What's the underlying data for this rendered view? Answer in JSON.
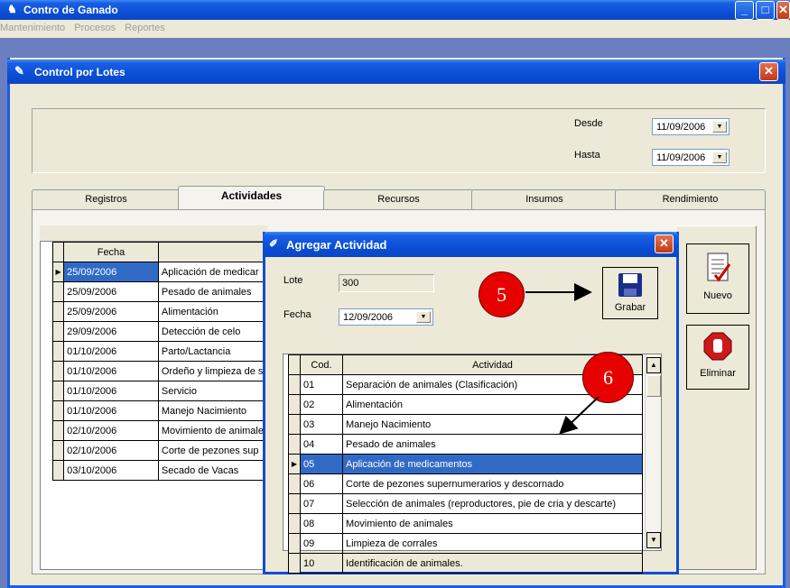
{
  "app": {
    "title": "Contro de Ganado"
  },
  "menu": [
    "Mantenimiento",
    "Procesos",
    "Reportes"
  ],
  "child": {
    "title": "Control por Lotes"
  },
  "filters": {
    "desde_label": "Desde",
    "desde_value": "11/09/2006",
    "hasta_label": "Hasta",
    "hasta_value": "11/09/2006"
  },
  "tabs": [
    "Registros",
    "Actividades",
    "Recursos",
    "Insumos",
    "Rendimiento"
  ],
  "active_tab": "Actividades",
  "main_grid": {
    "header": "Fecha",
    "rows": [
      [
        "25/09/2006",
        "Aplicación de medicar"
      ],
      [
        "25/09/2006",
        "Pesado de animales"
      ],
      [
        "25/09/2006",
        "Alimentación"
      ],
      [
        "29/09/2006",
        "Detección de celo"
      ],
      [
        "01/10/2006",
        "Parto/Lactancia"
      ],
      [
        "01/10/2006",
        "Ordeño y limpieza de s"
      ],
      [
        "01/10/2006",
        "Servicio"
      ],
      [
        "01/10/2006",
        "Manejo Nacimiento"
      ],
      [
        "02/10/2006",
        "Movimiento de animale"
      ],
      [
        "02/10/2006",
        "Corte de pezones sup"
      ],
      [
        "03/10/2006",
        "Secado de Vacas"
      ]
    ]
  },
  "buttons": {
    "nuevo": "Nuevo",
    "eliminar": "Eliminar"
  },
  "dialog": {
    "title": "Agregar Actividad",
    "lote_label": "Lote",
    "lote_value": "300",
    "fecha_label": "Fecha",
    "fecha_value": "12/09/2006",
    "grabar": "Grabar",
    "grid_headers": [
      "Cod.",
      "Actividad"
    ],
    "rows": [
      [
        "01",
        "Separación de animales (Clasificación)"
      ],
      [
        "02",
        "Alimentación"
      ],
      [
        "03",
        "Manejo Nacimiento"
      ],
      [
        "04",
        "Pesado de animales"
      ],
      [
        "05",
        "Aplicación de medicamentos"
      ],
      [
        "06",
        "Corte de pezones supernumerarios y descornado"
      ],
      [
        "07",
        "Selección de animales (reproductores, pie de cria y descarte)"
      ],
      [
        "08",
        "Movimiento de animales"
      ],
      [
        "09",
        "Limpieza de corrales"
      ],
      [
        "10",
        "Identificación de animales."
      ]
    ],
    "selected_code": "05"
  },
  "annotations": [
    "5",
    "6"
  ]
}
